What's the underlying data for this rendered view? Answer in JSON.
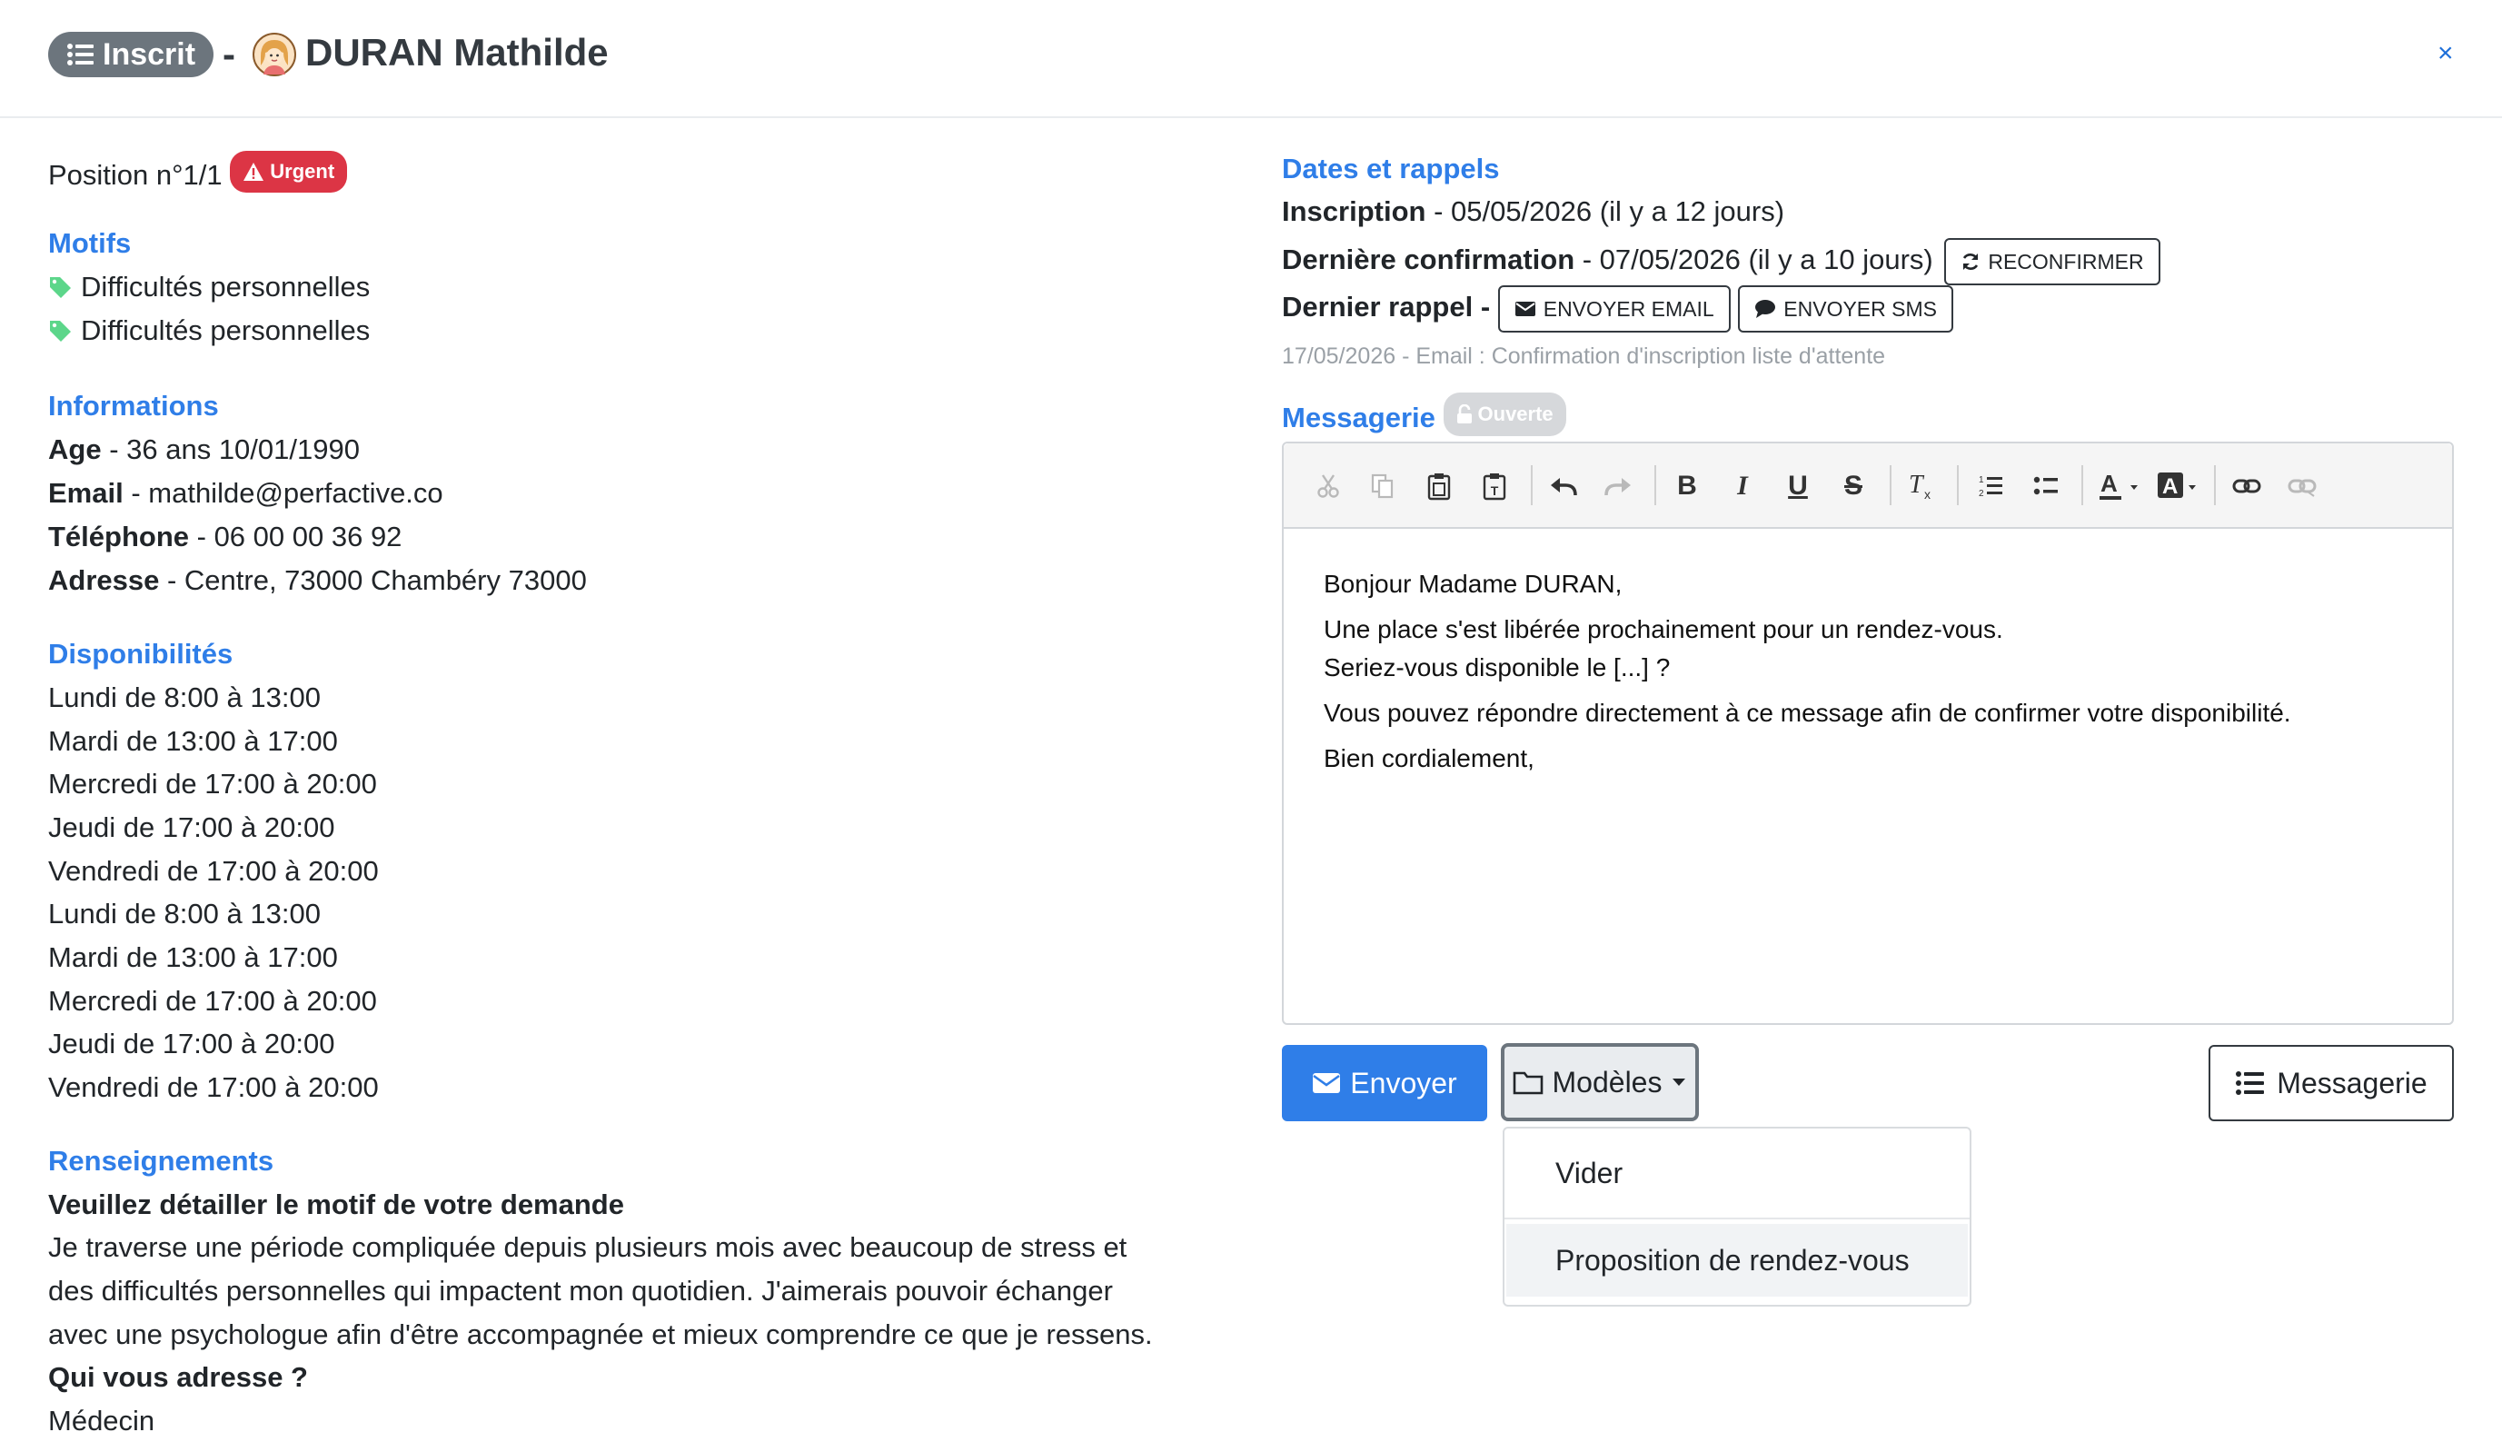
{
  "header": {
    "status_label": "Inscrit",
    "separator": "-",
    "name": "DURAN Mathilde",
    "close": "×"
  },
  "left": {
    "position_label": "Position n°1/1",
    "urgent_badge": "Urgent",
    "motifs": {
      "title": "Motifs",
      "items": [
        "Difficultés personnelles",
        "Difficultés personnelles"
      ]
    },
    "informations": {
      "title": "Informations",
      "rows": [
        {
          "label": "Age",
          "value": " - 36 ans 10/01/1990"
        },
        {
          "label": "Email",
          "value": " - mathilde@perfactive.co"
        },
        {
          "label": "Téléphone",
          "value": " - 06 00 00 36 92"
        },
        {
          "label": "Adresse",
          "value": " - Centre, 73000 Chambéry 73000"
        }
      ]
    },
    "disponibilites": {
      "title": "Disponibilités",
      "items": [
        "Lundi de 8:00 à 13:00",
        "Mardi de 13:00 à 17:00",
        "Mercredi de 17:00 à 20:00",
        "Jeudi de 17:00 à 20:00",
        "Vendredi de 17:00 à 20:00",
        "Lundi de 8:00 à 13:00",
        "Mardi de 13:00 à 17:00",
        "Mercredi de 17:00 à 20:00",
        "Jeudi de 17:00 à 20:00",
        "Vendredi de 17:00 à 20:00"
      ]
    },
    "renseignements": {
      "title": "Renseignements",
      "q1": "Veuillez détailler le motif de votre demande",
      "a1": [
        "Je traverse une période compliquée depuis plusieurs mois avec beaucoup de stress et",
        "des difficultés personnelles qui impactent mon quotidien. J'aimerais pouvoir échanger",
        "avec une psychologue afin d'être accompagnée et mieux comprendre ce que je ressens."
      ],
      "q2": "Qui vous adresse ?",
      "a2": "Médecin"
    }
  },
  "right": {
    "dates_title": "Dates et rappels",
    "inscription": {
      "label": "Inscription",
      "value": " - 05/05/2026 (il y a 12 jours)"
    },
    "confirmation": {
      "label": "Dernière confirmation",
      "value": " - 07/05/2026 (il y a 10 jours)"
    },
    "reconfirm_button": "RECONFIRMER",
    "rappel": {
      "label": "Dernier rappel",
      "sep": " - "
    },
    "email_button": "ENVOYER EMAIL",
    "sms_button": "ENVOYER SMS",
    "history": "17/05/2026 - Email : Confirmation d'inscription liste d'attente",
    "messagerie_title": "Messagerie",
    "messagerie_badge": "Ouverte",
    "editor_lines": [
      "Bonjour Madame DURAN,",
      "Une place s'est libérée prochainement pour un rendez-vous.",
      "Seriez-vous disponible le [...] ?",
      "Vous pouvez répondre directement à ce message afin de confirmer votre disponibilité.",
      "Bien cordialement,"
    ],
    "toolbar_icons": [
      "cut-icon",
      "copy-icon",
      "paste-icon",
      "paste-text-icon",
      "undo-icon",
      "redo-icon",
      "bold-icon",
      "italic-icon",
      "underline-icon",
      "strikethrough-icon",
      "clear-format-icon",
      "numbered-list-icon",
      "bulleted-list-icon",
      "text-color-icon",
      "background-color-icon",
      "link-icon",
      "unlink-icon"
    ],
    "send_button": "Envoyer",
    "models_button": "Modèles",
    "messagerie_button": "Messagerie",
    "dropdown": [
      "Vider",
      "Proposition de rendez-vous"
    ]
  },
  "colors": {
    "accent": "#2f7ee8",
    "status_pill": "#6c757d",
    "urgent": "#dc3545",
    "tag": "#5cd68a",
    "dropdown_active": "#f1f3f5"
  }
}
